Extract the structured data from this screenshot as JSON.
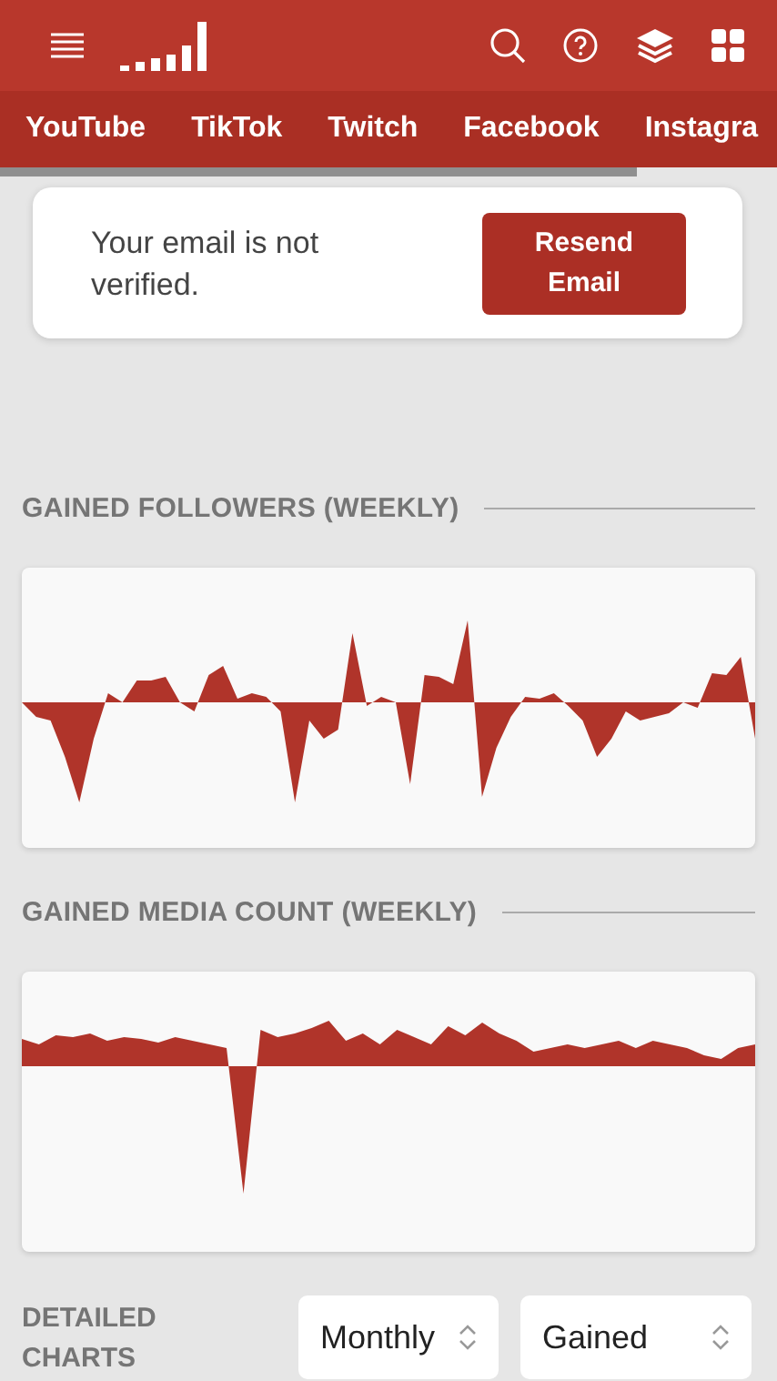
{
  "tabs": [
    {
      "label": "YouTube"
    },
    {
      "label": "TikTok"
    },
    {
      "label": "Twitch"
    },
    {
      "label": "Facebook"
    },
    {
      "label": "Instagra"
    }
  ],
  "notice": {
    "message": "Your email is not verified.",
    "button": "Resend Email"
  },
  "sections": [
    {
      "title": "GAINED FOLLOWERS (WEEKLY)",
      "kind": "followers"
    },
    {
      "title": "GAINED MEDIA COUNT (WEEKLY)",
      "kind": "media"
    }
  ],
  "detailed": {
    "title": "DETAILED CHARTS",
    "selects": [
      {
        "value": "Monthly"
      },
      {
        "value": "Gained"
      }
    ]
  }
}
